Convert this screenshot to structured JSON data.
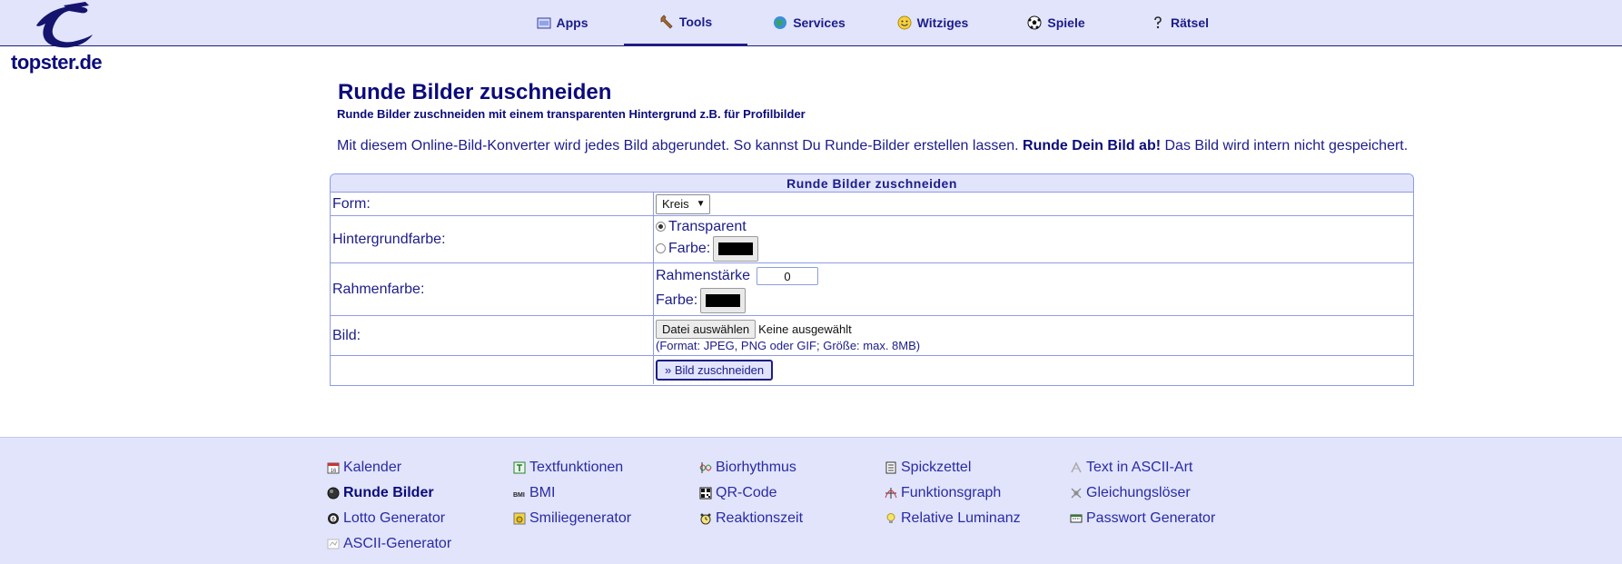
{
  "site": {
    "logo_text": "topster.de"
  },
  "nav": {
    "items": [
      {
        "label": "Apps",
        "icon": "apps-icon"
      },
      {
        "label": "Tools",
        "icon": "wrench-icon",
        "active": true
      },
      {
        "label": "Services",
        "icon": "globe-icon"
      },
      {
        "label": "Witziges",
        "icon": "smiley-icon"
      },
      {
        "label": "Spiele",
        "icon": "soccer-ball-icon"
      },
      {
        "label": "Rätsel",
        "icon": "question-icon"
      }
    ]
  },
  "main": {
    "title": "Runde Bilder zuschneiden",
    "subtitle": "Runde Bilder zuschneiden mit einem transparenten Hintergrund z.B. für Profilbilder",
    "intro_part1": "Mit diesem Online-Bild-Konverter wird jedes Bild abgerundet. So kannst Du Runde-Bilder erstellen lassen.",
    "intro_bold": "Runde Dein Bild ab!",
    "intro_part2": "Das Bild wird intern nicht gespeichert."
  },
  "form": {
    "heading": "Runde Bilder zuschneiden",
    "form_label": "Form:",
    "form_value": "Kreis",
    "background_label": "Hintergrundfarbe:",
    "transparent_label": "Transparent",
    "color_label": "Farbe:",
    "border_label": "Rahmenfarbe:",
    "border_width_label": "Rahmenstärke",
    "border_width_value": "0",
    "border_color_label": "Farbe:",
    "image_label": "Bild:",
    "file_button": "Datei auswählen",
    "file_status": "Keine ausgewählt",
    "file_hint": "(Format: JPEG, PNG oder GIF; Größe: max. 8MB)",
    "submit_label": "» Bild zuschneiden",
    "background_color": "#000000",
    "border_color": "#000000"
  },
  "footer": {
    "links": [
      {
        "label": "Kalender",
        "icon": "calendar-icon"
      },
      {
        "label": "Textfunktionen",
        "icon": "text-icon"
      },
      {
        "label": "Biorhythmus",
        "icon": "biorhythm-icon"
      },
      {
        "label": "Spickzettel",
        "icon": "note-icon"
      },
      {
        "label": "Text in ASCII-Art",
        "icon": "ascii-art-icon"
      },
      {
        "label": "Runde Bilder",
        "icon": "round-image-icon",
        "active": true
      },
      {
        "label": "BMI",
        "icon": "bmi-icon"
      },
      {
        "label": "QR-Code",
        "icon": "qr-code-icon"
      },
      {
        "label": "Funktionsgraph",
        "icon": "graph-icon"
      },
      {
        "label": "Gleichungslöser",
        "icon": "equation-icon"
      },
      {
        "label": "Lotto Generator",
        "icon": "lotto-ball-icon"
      },
      {
        "label": "Smiliegenerator",
        "icon": "smilie-icon"
      },
      {
        "label": "Reaktionszeit",
        "icon": "alarm-clock-icon"
      },
      {
        "label": "Relative Luminanz",
        "icon": "lightbulb-icon"
      },
      {
        "label": "Passwort Generator",
        "icon": "password-icon"
      },
      {
        "label": "ASCII-Generator",
        "icon": "ascii-icon"
      }
    ]
  }
}
